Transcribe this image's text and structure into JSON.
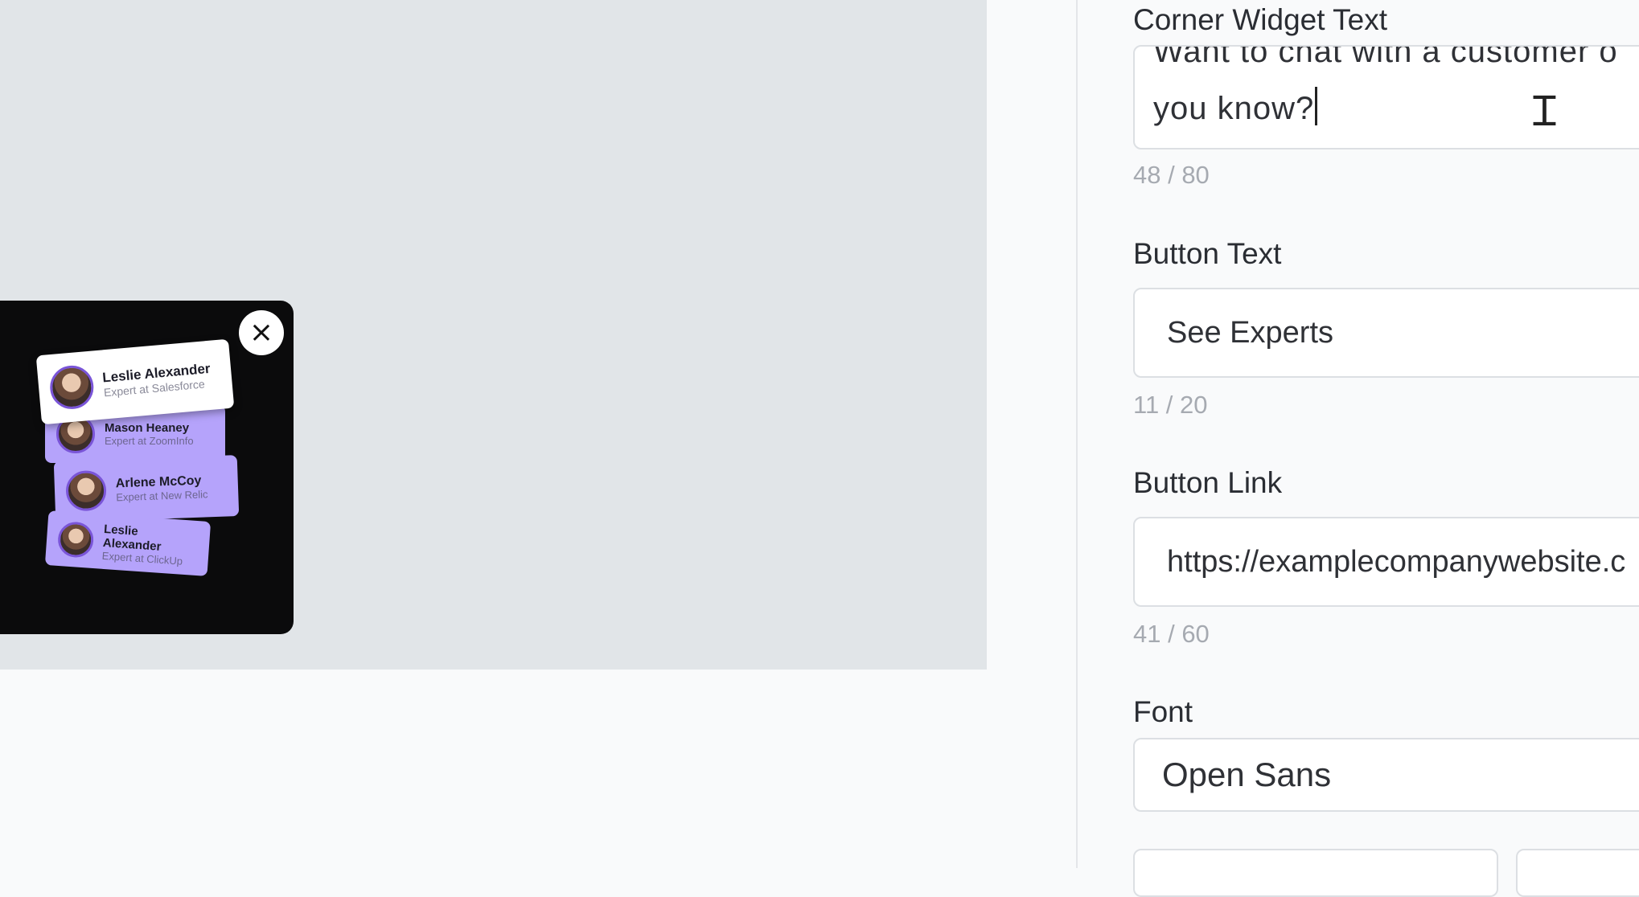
{
  "preview": {
    "close_icon": "×",
    "cards": [
      {
        "name": "Leslie Alexander",
        "role": "Expert at Salesforce"
      },
      {
        "name": "Mason Heaney",
        "role": "Expert at ZoomInfo"
      },
      {
        "name": "Arlene McCoy",
        "role": "Expert at New Relic"
      },
      {
        "name": "Leslie Alexander",
        "role": "Expert at ClickUp"
      }
    ]
  },
  "form": {
    "corner_widget_text": {
      "label": "Corner Widget Text",
      "value_line1": "Want to chat with a customer o",
      "value_line2": "you know?",
      "counter": "48 / 80"
    },
    "button_text": {
      "label": "Button Text",
      "value": "See Experts",
      "counter": "11 / 20"
    },
    "button_link": {
      "label": "Button Link",
      "value": "https://examplecompanywebsite.c",
      "counter": "41 / 60"
    },
    "font": {
      "label": "Font",
      "value": "Open Sans"
    }
  },
  "colors": {
    "preview_bg": "#e1e5e8",
    "widget_bg": "#0b0b0c",
    "card_purple": "#b5a3fb",
    "panel_bg": "#f9fafb"
  }
}
